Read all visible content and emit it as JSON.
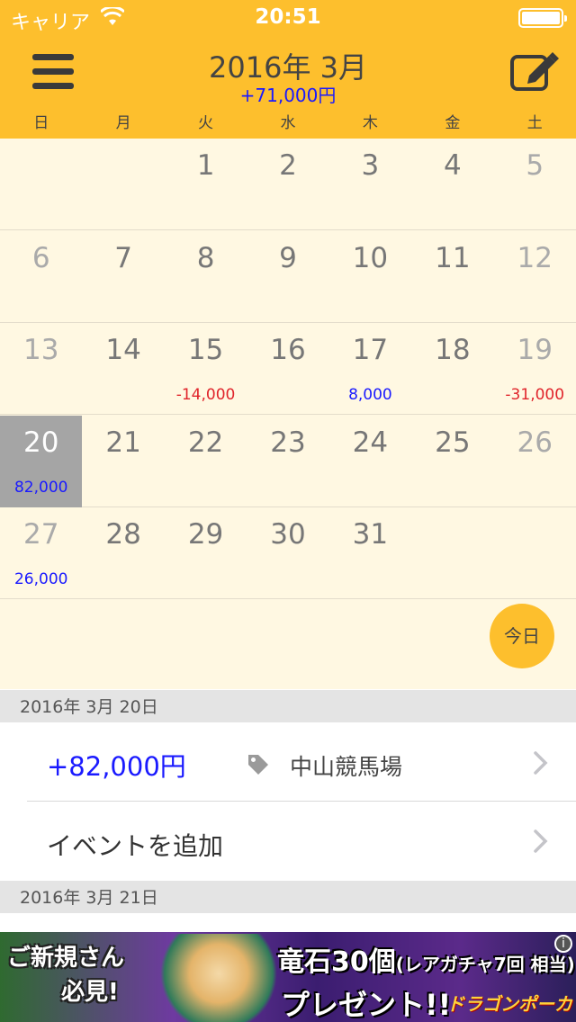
{
  "status_bar": {
    "carrier": "キャリア",
    "time": "20:51"
  },
  "header": {
    "month_title": "2016年 3月",
    "month_total": "+71,000円",
    "weekdays": [
      "日",
      "月",
      "火",
      "水",
      "木",
      "金",
      "土"
    ]
  },
  "calendar": {
    "weeks": [
      [
        {
          "day": ""
        },
        {
          "day": ""
        },
        {
          "day": "1"
        },
        {
          "day": "2"
        },
        {
          "day": "3"
        },
        {
          "day": "4"
        },
        {
          "day": "5"
        }
      ],
      [
        {
          "day": "6"
        },
        {
          "day": "7"
        },
        {
          "day": "8"
        },
        {
          "day": "9"
        },
        {
          "day": "10"
        },
        {
          "day": "11"
        },
        {
          "day": "12"
        }
      ],
      [
        {
          "day": "13"
        },
        {
          "day": "14"
        },
        {
          "day": "15",
          "amount": "-14,000",
          "sign": "neg"
        },
        {
          "day": "16"
        },
        {
          "day": "17",
          "amount": "8,000",
          "sign": "pos"
        },
        {
          "day": "18"
        },
        {
          "day": "19",
          "amount": "-31,000",
          "sign": "neg"
        }
      ],
      [
        {
          "day": "20",
          "amount": "82,000",
          "sign": "pos",
          "selected": true
        },
        {
          "day": "21"
        },
        {
          "day": "22"
        },
        {
          "day": "23"
        },
        {
          "day": "24"
        },
        {
          "day": "25"
        },
        {
          "day": "26"
        }
      ],
      [
        {
          "day": "27",
          "amount": "26,000",
          "sign": "pos"
        },
        {
          "day": "28"
        },
        {
          "day": "29"
        },
        {
          "day": "30"
        },
        {
          "day": "31"
        },
        {
          "day": ""
        },
        {
          "day": ""
        }
      ]
    ],
    "today_button": "今日"
  },
  "events": {
    "section1_date": "2016年 3月 20日",
    "event_amount": "+82,000円",
    "event_place": "中山競馬場",
    "add_event_label": "イベントを追加",
    "section2_date": "2016年 3月 21日"
  },
  "ad": {
    "left_line1": "ご新規さん",
    "left_line2": "必見!",
    "right_line1": "竜石30個",
    "right_line1_small": "(レアガチャ7回 相当)",
    "right_line2": "プレゼント!!",
    "logo": "ドラゴンポーカー",
    "info": "i"
  },
  "colors": {
    "header_bg": "#fdbf2d",
    "calendar_bg": "#fff8e2",
    "positive": "#1a1aff",
    "negative": "#e0242b",
    "selected_day": "#a5a5a5"
  },
  "icons": [
    "wifi-icon",
    "battery-icon",
    "menu-icon",
    "edit-icon",
    "tag-icon",
    "chevron-right-icon",
    "info-icon"
  ]
}
